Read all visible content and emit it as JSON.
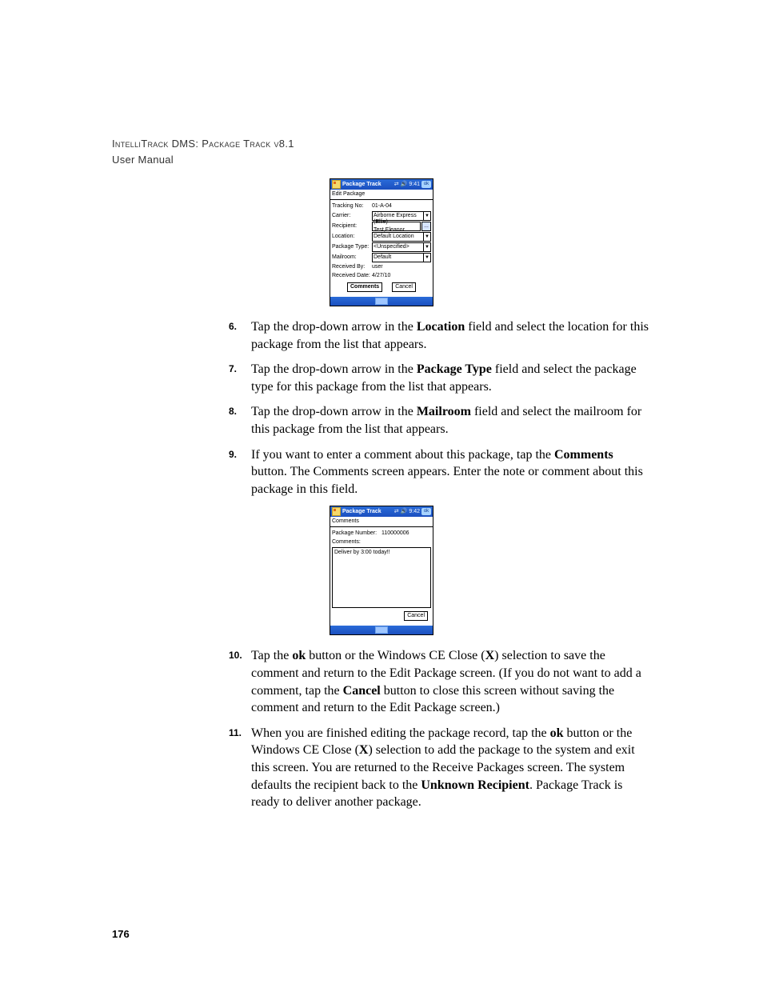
{
  "header": {
    "line1": "IntelliTrack DMS: Package Track v8.1",
    "line2": "User Manual"
  },
  "page_number": "176",
  "screenshot1": {
    "app_title": "Package Track",
    "time": "9:41",
    "ok": "ok",
    "subtitle": "Edit Package",
    "fields": {
      "tracking_no_label": "Tracking No:",
      "tracking_no_value": "01-A-04",
      "carrier_label": "Carrier:",
      "carrier_value": "Airborne Express",
      "recipient_label": "Recipient:",
      "recipient_value": "(Ellie) Test,Eleanor",
      "location_label": "Location:",
      "location_value": "Default Location",
      "package_type_label": "Package Type:",
      "package_type_value": "<Unspecified>",
      "mailroom_label": "Mailroom:",
      "mailroom_value": "Default",
      "received_by_label": "Received By:",
      "received_by_value": "user",
      "received_date_label": "Received Date:",
      "received_date_value": "4/27/10"
    },
    "buttons": {
      "comments": "Comments",
      "cancel": "Cancel"
    }
  },
  "screenshot2": {
    "app_title": "Package Track",
    "time": "9:42",
    "ok": "ok",
    "subtitle": "Comments",
    "package_number_label": "Package Number:",
    "package_number_value": "110000006",
    "comments_label": "Comments:",
    "comments_value": "Deliver by 3:00 today!!",
    "cancel": "Cancel"
  },
  "steps": {
    "s6": {
      "num": "6.",
      "pre": "Tap the drop-down arrow in the ",
      "bold": "Location",
      "post": " field and select the location for this package from the list that appears."
    },
    "s7": {
      "num": "7.",
      "pre": "Tap the drop-down arrow in the ",
      "bold": "Package Type",
      "post": " field and select the package type for this package from the list that appears."
    },
    "s8": {
      "num": "8.",
      "pre": "Tap the drop-down arrow in the ",
      "bold": "Mailroom",
      "post": " field and select the mailroom for this package from the list that appears."
    },
    "s9": {
      "num": "9.",
      "pre": "If you want to enter a comment about this package, tap the ",
      "bold": "Comments",
      "post": " button. The Comments screen appears. Enter the note or comment about this package in this field."
    },
    "s10": {
      "num": "10.",
      "p1a": "Tap the ",
      "b1": "ok",
      "p1b": " button or the Windows CE Close (",
      "b2": "X",
      "p1c": ") selection to save the comment and return to the Edit Package screen. (If you do not want to add a comment, tap the ",
      "b3": "Cancel",
      "p1d": " button to close this screen without saving the comment and return to the Edit Package screen.)"
    },
    "s11": {
      "num": "11.",
      "p1a": "When you are finished editing the package record, tap the ",
      "b1": "ok",
      "p1b": " button or the Windows CE Close (",
      "b2": "X",
      "p1c": ") selection to add the package to the system and exit this screen. You are returned to the Receive Packages screen. The system defaults the recipient back to the ",
      "b3": "Unknown Recipient",
      "p1d": ". Package Track is ready to deliver another package."
    }
  }
}
